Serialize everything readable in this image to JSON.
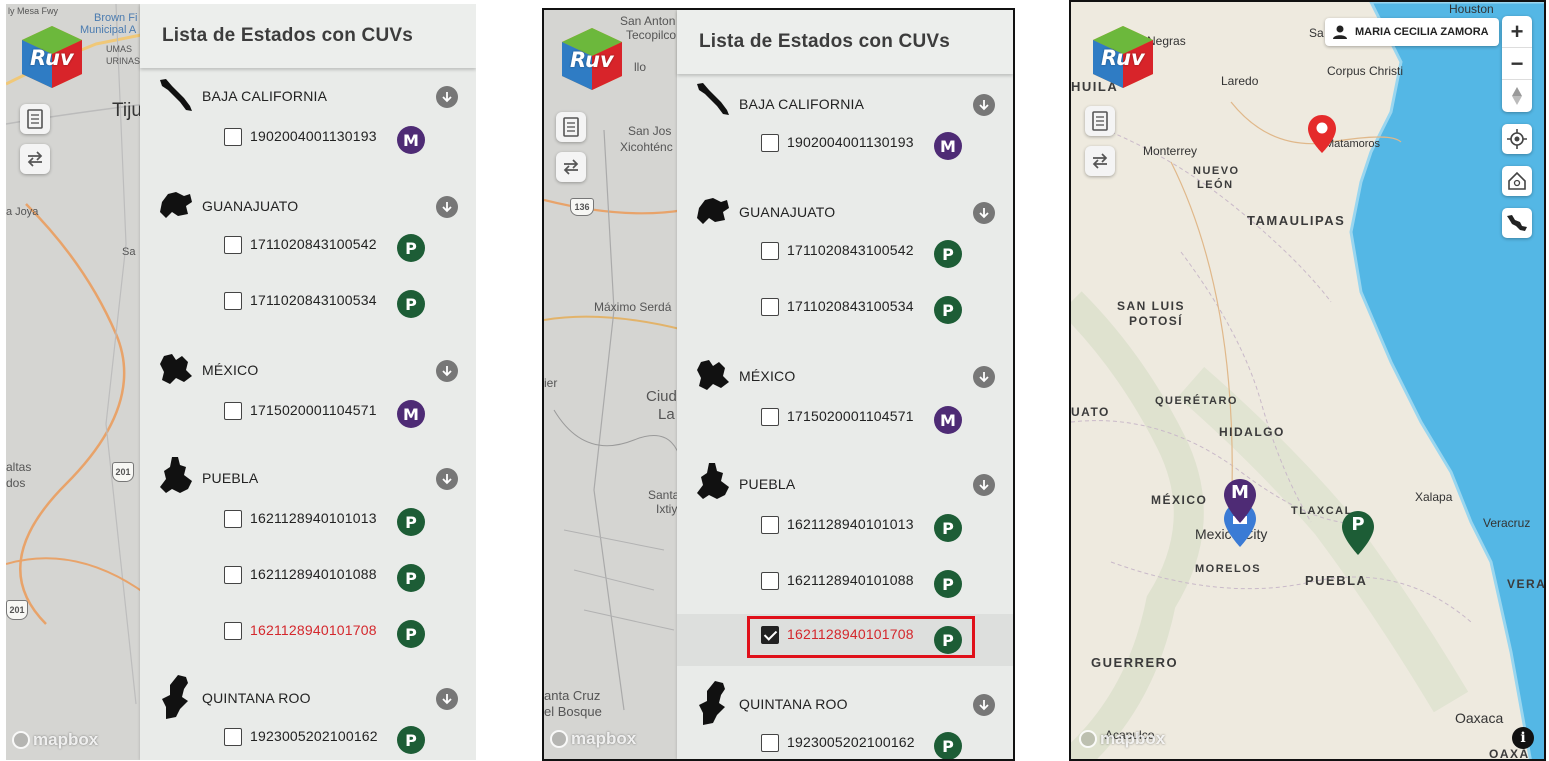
{
  "panel": {
    "title": "Lista de Estados con CUVs",
    "states": [
      {
        "name": "BAJA CALIFORNIA",
        "cuvs": [
          {
            "id": "1902004001130193",
            "type": "M"
          }
        ]
      },
      {
        "name": "GUANAJUATO",
        "cuvs": [
          {
            "id": "1711020843100542",
            "type": "P"
          },
          {
            "id": "1711020843100534",
            "type": "P"
          }
        ]
      },
      {
        "name": "MÉXICO",
        "cuvs": [
          {
            "id": "1715020001104571",
            "type": "M"
          }
        ]
      },
      {
        "name": "PUEBLA",
        "cuvs": [
          {
            "id": "1621128940101013",
            "type": "P"
          },
          {
            "id": "1621128940101088",
            "type": "P"
          },
          {
            "id": "1621128940101708",
            "type": "P"
          }
        ]
      },
      {
        "name": "QUINTANA ROO",
        "cuvs": [
          {
            "id": "1923005202100162",
            "type": "P"
          }
        ]
      }
    ]
  },
  "logo": {
    "text": "Ruv"
  },
  "attribution": {
    "mapbox": "mapbox"
  },
  "screen1": {
    "highlighted_cuv": "1621128940101708",
    "map_labels": {
      "top1": "ly Mesa Fwy",
      "top2": "Brown Fi",
      "top3": "Municipal A",
      "top4": "UMAS",
      "top5": "URINAS",
      "tij": "Tiju",
      "joya": "a Joya",
      "sa": "Sa",
      "altas": "altas",
      "dos": "dos",
      "hwy1": "201",
      "hwy2": "201"
    }
  },
  "screen2": {
    "checked_cuv": "1621128940101708",
    "map_labels": {
      "a": "San Anton",
      "b": "Tecopilco",
      "c": "llo",
      "d": "San Jos",
      "e": "Xicohténc",
      "f": "136",
      "g": "Máximo Serdá",
      "h": "ier",
      "i": "Ciud",
      "j": "La",
      "k": "Santa",
      "l": "Ixtiy",
      "m": "anta Cruz",
      "n": "el Bosque"
    }
  },
  "screen3": {
    "user_name": "MARIA CECILIA ZAMORA",
    "zoom_in": "+",
    "zoom_out": "−",
    "info": "i",
    "map_labels": {
      "piedras": "iedras Negras",
      "houston": "Houston",
      "sa": "Sa",
      "corpus": "Corpus Christi",
      "laredo": "Laredo",
      "hila": "HUILA",
      "monterrey": "Monterrey",
      "nuevo": "NUEVO",
      "leon": "LEÓN",
      "matamoros": "Matamoros",
      "tamaulipas": "TAMAULIPAS",
      "sanluis": "SAN LUIS",
      "potosi": "POTOSÍ",
      "queretaro": "QUERÉTARO",
      "uato": "UATO",
      "hidalgo": "HIDALGO",
      "mexico": "MÉXICO",
      "mexcity": "Mexico City",
      "tlaxcala": "TLAXCAL",
      "xalapa": "Xalapa",
      "veracruz": "Veracruz",
      "morelos": "MORELOS",
      "puebla": "PUEBLA",
      "vera": "VERA",
      "guerrero": "GUERRERO",
      "oaxaca": "Oaxaca",
      "acapulco": "Acapulco",
      "oaxa": "OAXA"
    },
    "pins": {
      "m": "M",
      "p": "P"
    }
  },
  "colors": {
    "panel_bg": "#e9ebe9",
    "badge_p": "#1d5d36",
    "badge_m": "#4e2b75",
    "highlight_red": "#d4272c",
    "box_red": "#e0101a",
    "water": "#54b7e5"
  },
  "icons": [
    "book-icon",
    "swap-icon",
    "arrow-down-icon",
    "user-icon",
    "compass-icon",
    "locate-icon",
    "home-icon",
    "mexico-map-icon",
    "info-icon",
    "map-pin-icon"
  ]
}
